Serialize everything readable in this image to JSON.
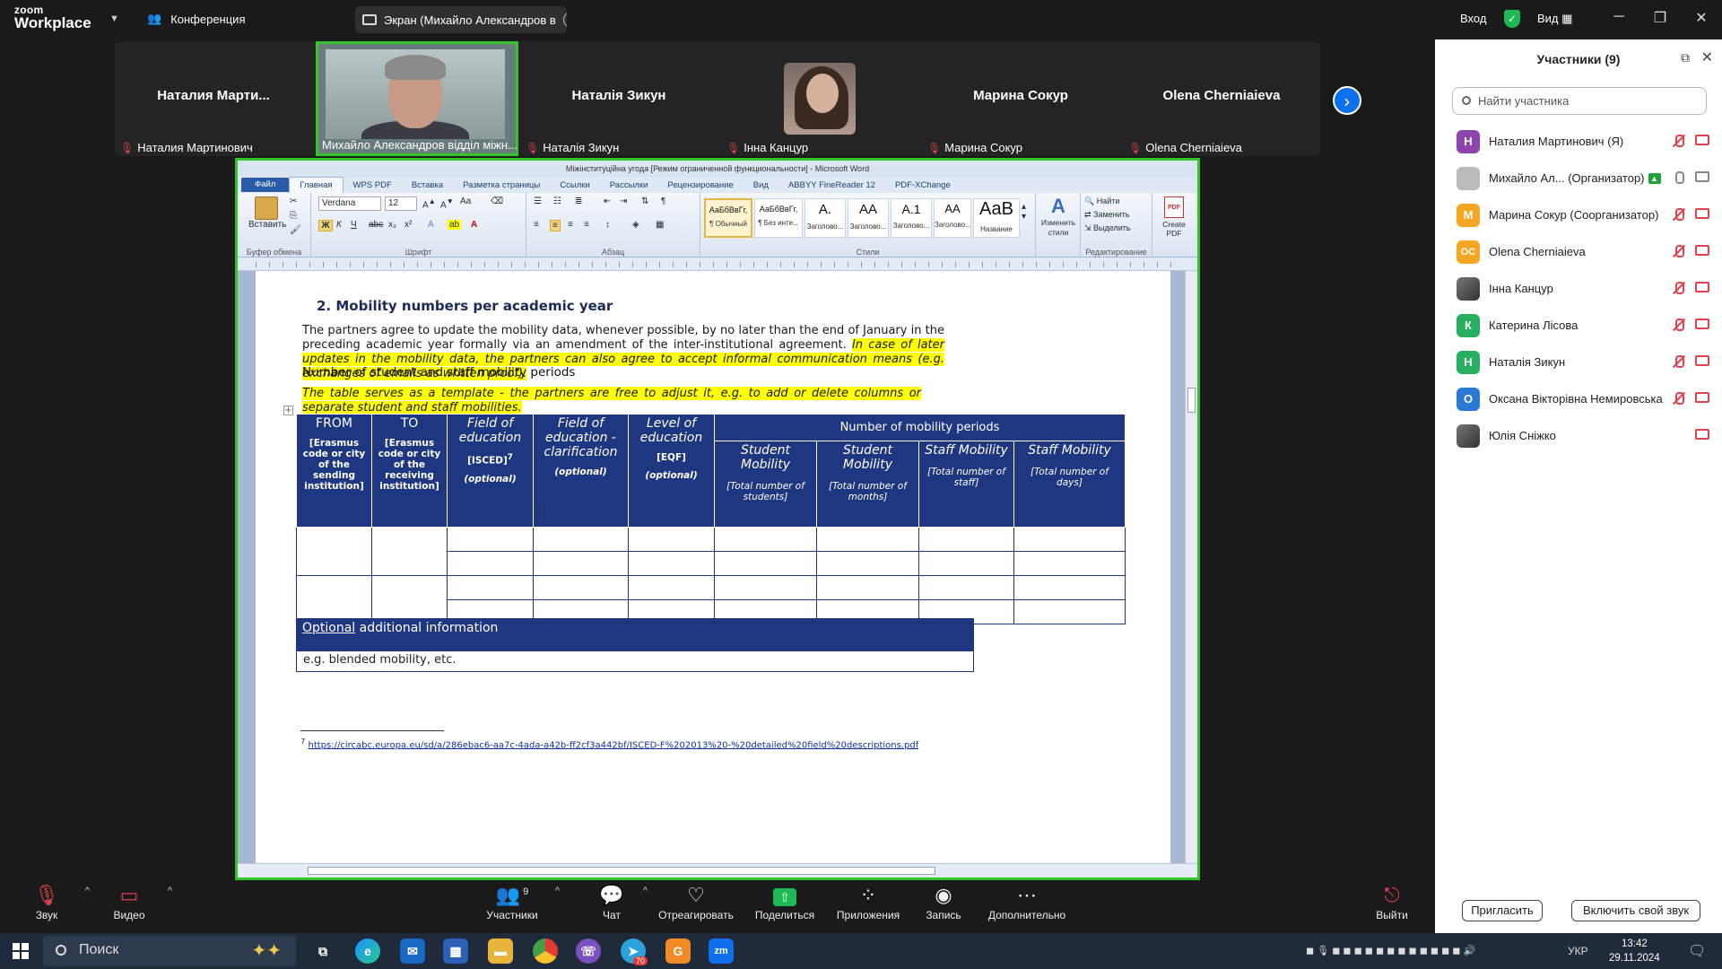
{
  "topbar": {
    "logo_top": "zoom",
    "logo_bottom": "Workplace",
    "conference": "Конференция",
    "screen_tab": "Экран (Михайло Александров в",
    "signin": "Вход",
    "view": "Вид"
  },
  "video": {
    "tiles": [
      {
        "name": "Наталия  Марти...",
        "label": "Наталия Мартинович"
      },
      {
        "name": "",
        "label": "Михайло Александров відділ міжн..."
      },
      {
        "name": "Наталія Зикун",
        "label": "Наталія Зикун"
      },
      {
        "name": "",
        "label": "Інна Канцур"
      },
      {
        "name": "Марина Сокур",
        "label": "Марина Сокур"
      },
      {
        "name": "Olena Cherniaieva",
        "label": "Olena Cherniaieva"
      }
    ]
  },
  "word": {
    "title": "Міжінституційна угода [Режим ограниченной функциональности]  -  Microsoft Word",
    "tabs": [
      "Файл",
      "Главная",
      "WPS PDF",
      "Вставка",
      "Разметка страницы",
      "Ссылки",
      "Рассылки",
      "Рецензирование",
      "Вид",
      "ABBYY FineReader 12",
      "PDF-XChange"
    ],
    "ribbon": {
      "paste": "Вставить",
      "font_name": "Verdana",
      "font_size": "12",
      "groups": [
        "Буфер обмена",
        "Шрифт",
        "Абзац",
        "Стили",
        "Редактирование"
      ],
      "styles": [
        {
          "preview": "АаБбВвГг,",
          "name": "¶ Обычный"
        },
        {
          "preview": "АаБбВвГг,",
          "name": "¶ Без инте..."
        },
        {
          "preview": "А.",
          "name": "Заголово..."
        },
        {
          "preview": "АА",
          "name": "Заголово..."
        },
        {
          "preview": "А.1",
          "name": "Заголово..."
        },
        {
          "preview": "АА",
          "name": "Заголово..."
        },
        {
          "preview": "АаВ",
          "name": "Название"
        }
      ],
      "change_styles": "Изменить стили",
      "find": "Найти",
      "replace": "Заменить",
      "select": "Выделить",
      "create_pdf": "Create PDF"
    }
  },
  "doc": {
    "heading": "2.  Mobility numbers per academic year",
    "para1_plain": "The partners agree to update the mobility data, whenever possible, by no later than the end of January in the preceding academic year formally via an amendment of the inter-institutional agreement. ",
    "para1_highlight": "In case of later updates in the mobility data, the partners can also agree to accept informal communication means (e.g. exchanges of emails as written proof).",
    "subheading": "Number of student and staff mobility  periods",
    "para2_highlight": "The table serves as a template - the partners are free to adjust it, e.g. to add or delete columns or separate student and staff mobilities.",
    "table": {
      "from": "FROM",
      "from_sub": "[Erasmus code or city of the sending institution]",
      "to": "TO",
      "to_sub": "[Erasmus code or city of the receiving institution]",
      "field": "Field of education",
      "field_sub": "[ISCED]",
      "field_sup": "7",
      "field_opt": "(optional)",
      "clar": "Field of education - clarification",
      "clar_opt": "(optional)",
      "level": "Level of education",
      "level_sub": "[EQF]",
      "level_opt": "(optional)",
      "periods": "Number of mobility periods",
      "cols": [
        {
          "title": "Student Mobility",
          "sub": "[Total number of students]"
        },
        {
          "title": "Student Mobility",
          "sub": "[Total number of months]"
        },
        {
          "title": "Staff Mobility",
          "sub": "[Total number of staff]"
        },
        {
          "title": "Staff Mobility",
          "sub": "[Total number of days]"
        }
      ]
    },
    "optional_underlined": "Optional",
    "optional_rest": " additional  information",
    "optional_example": "e.g. blended mobility, etc.",
    "footnote_num": "7",
    "footnote_url": "https://circabc.europa.eu/sd/a/286ebac6-aa7c-4ada-a42b-ff2cf3a442bf/ISCED-F%202013%20-%20detailed%20field%20descriptions.pdf"
  },
  "panel": {
    "title": "Участники (9)",
    "search_placeholder": "Найти участника",
    "participants": [
      {
        "initial": "Н",
        "color": "#8e44ad",
        "name": "Наталия Мартинович (Я)",
        "mic": "off",
        "cam": "off"
      },
      {
        "initial": "",
        "color": "#999999",
        "name": "Михайло Ал... (Организатор)",
        "mic": "on",
        "cam": "on",
        "badge": true
      },
      {
        "initial": "М",
        "color": "#f5a623",
        "name": "Марина Сокур (Соорганизатор)",
        "mic": "off",
        "cam": "off"
      },
      {
        "initial": "OC",
        "color": "#f5a623",
        "name": "Olena Cherniaieva",
        "mic": "off",
        "cam": "off"
      },
      {
        "initial": "",
        "color": "#555555",
        "name": "Інна Канцур",
        "mic": "off",
        "cam": "off"
      },
      {
        "initial": "К",
        "color": "#27ae60",
        "name": "Катерина Лісова",
        "mic": "off",
        "cam": "off"
      },
      {
        "initial": "Н",
        "color": "#27ae60",
        "name": "Наталія Зикун",
        "mic": "off",
        "cam": "off"
      },
      {
        "initial": "О",
        "color": "#2a7ad5",
        "name": "Оксана Вікторівна Немировська",
        "mic": "off",
        "cam": "off"
      },
      {
        "initial": "",
        "color": "#444444",
        "name": "Юлія Сніжко",
        "mic": "none",
        "cam": "off"
      }
    ],
    "invite": "Пригласить",
    "unmute": "Включить свой звук"
  },
  "controls": {
    "audio": "Звук",
    "video": "Видео",
    "participants": "Участники",
    "participants_count": "9",
    "chat": "Чат",
    "react": "Отреагировать",
    "share": "Поделиться",
    "apps": "Приложения",
    "record": "Запись",
    "more": "Дополнительно",
    "leave": "Выйти"
  },
  "taskbar": {
    "search": "Поиск",
    "lang": "УКР",
    "time": "13:42",
    "date": "29.11.2024",
    "badge": "70"
  }
}
